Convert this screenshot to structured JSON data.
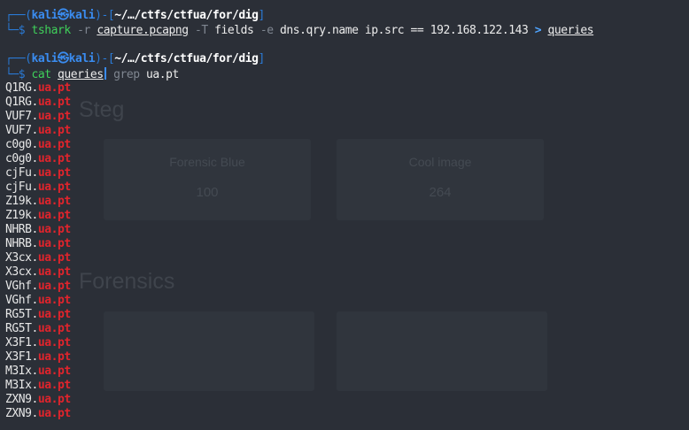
{
  "terminal": {
    "prompt1": {
      "frame_left": "┌──(",
      "user": "kali",
      "at_symbol": "㉿",
      "host": "kali",
      "frame_mid": ")-[",
      "path": "~/…/ctfs/ctfua/for/dig",
      "frame_right": "]",
      "input_frame": "└─$ "
    },
    "command1": {
      "program": "tshark",
      "flag_r": "-r",
      "file": "capture.pcapng",
      "flag_T": "-T",
      "fields_arg": "fields",
      "flag_e": "-e",
      "field1": "dns.qry.name",
      "field2": "ip.src",
      "operator": "==",
      "ip": "192.168.122.143",
      "redirect": ">",
      "outfile": "queries"
    },
    "prompt2": {
      "frame_left": "┌──(",
      "user": "kali",
      "at_symbol": "㉿",
      "host": "kali",
      "frame_mid": ")-[",
      "path": "~/…/ctfs/ctfua/for/dig",
      "frame_right": "]",
      "input_frame": "└─$ "
    },
    "command2": {
      "program": "cat",
      "file": "queries",
      "grep": "grep",
      "pattern": "ua.pt"
    },
    "output_lines": [
      {
        "prefix": "Q1RG.",
        "match": "ua.pt"
      },
      {
        "prefix": "Q1RG.",
        "match": "ua.pt"
      },
      {
        "prefix": "VUF7.",
        "match": "ua.pt"
      },
      {
        "prefix": "VUF7.",
        "match": "ua.pt"
      },
      {
        "prefix": "c0g0.",
        "match": "ua.pt"
      },
      {
        "prefix": "c0g0.",
        "match": "ua.pt"
      },
      {
        "prefix": "cjFu.",
        "match": "ua.pt"
      },
      {
        "prefix": "cjFu.",
        "match": "ua.pt"
      },
      {
        "prefix": "Z19k.",
        "match": "ua.pt"
      },
      {
        "prefix": "Z19k.",
        "match": "ua.pt"
      },
      {
        "prefix": "NHRB.",
        "match": "ua.pt"
      },
      {
        "prefix": "NHRB.",
        "match": "ua.pt"
      },
      {
        "prefix": "X3cx.",
        "match": "ua.pt"
      },
      {
        "prefix": "X3cx.",
        "match": "ua.pt"
      },
      {
        "prefix": "VGhf.",
        "match": "ua.pt"
      },
      {
        "prefix": "VGhf.",
        "match": "ua.pt"
      },
      {
        "prefix": "RG5T.",
        "match": "ua.pt"
      },
      {
        "prefix": "RG5T.",
        "match": "ua.pt"
      },
      {
        "prefix": "X3F1.",
        "match": "ua.pt"
      },
      {
        "prefix": "X3F1.",
        "match": "ua.pt"
      },
      {
        "prefix": "M3Ix.",
        "match": "ua.pt"
      },
      {
        "prefix": "M3Ix.",
        "match": "ua.pt"
      },
      {
        "prefix": "ZXN9.",
        "match": "ua.pt"
      },
      {
        "prefix": "ZXN9.",
        "match": "ua.pt"
      }
    ]
  },
  "background_page": {
    "section1_heading": "Steg",
    "card1": {
      "title": "Forensic Blue",
      "value": "100"
    },
    "card2": {
      "title": "Cool image",
      "value": "264"
    },
    "section2_heading": "Forensics"
  },
  "colors": {
    "terminal_bg": "#2b2f37",
    "prompt_blue": "#3a8cf0",
    "command_green": "#3fd05a",
    "match_red": "#e0242c"
  }
}
